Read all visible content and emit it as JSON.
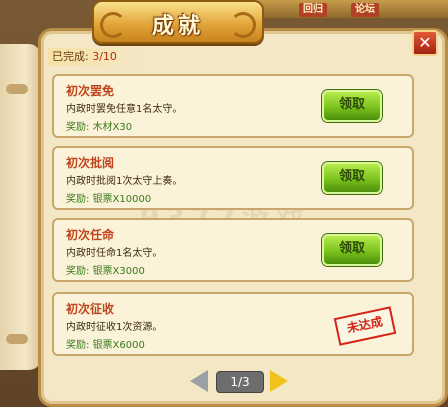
{
  "background": {
    "tabs": [
      "回归",
      "论坛"
    ]
  },
  "panel": {
    "title": "成就",
    "progress_label": "已完成:",
    "progress_value": "3/10",
    "close_label": "✕"
  },
  "watermark": "9377游戏",
  "achievements": [
    {
      "name": "初次罢免",
      "desc": "内政时罢免任意1名太守。",
      "reward_label": "奖励:",
      "reward_value": "木材X30",
      "state": "claim",
      "button_label": "领取"
    },
    {
      "name": "初次批阅",
      "desc": "内政时批阅1次太守上奏。",
      "reward_label": "奖励:",
      "reward_value": "银票X10000",
      "state": "claim",
      "button_label": "领取"
    },
    {
      "name": "初次任命",
      "desc": "内政时任命1名太守。",
      "reward_label": "奖励:",
      "reward_value": "银票X3000",
      "state": "claim",
      "button_label": "领取"
    },
    {
      "name": "初次征收",
      "desc": "内政时征收1次资源。",
      "reward_label": "奖励:",
      "reward_value": "银票X6000",
      "state": "unfinished",
      "button_label": "未达成"
    }
  ],
  "pager": {
    "indicator": "1/3"
  },
  "colors": {
    "accent": "#c0441c",
    "claim_green": "#7cc21d",
    "stamp_red": "#d42414"
  }
}
